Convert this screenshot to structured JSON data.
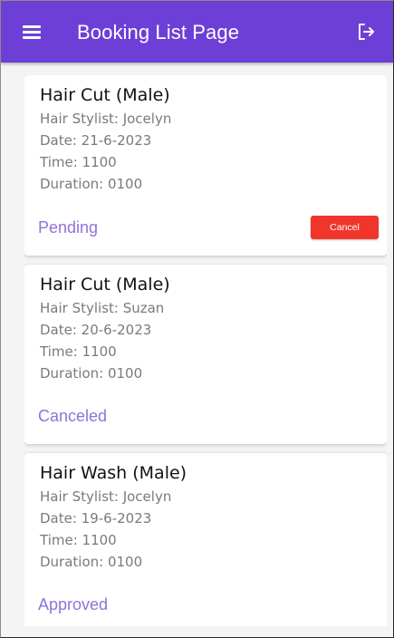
{
  "appbar": {
    "title": "Booking List Page",
    "menu_icon": "menu-icon",
    "logout_icon": "logout-icon",
    "color": "#6e3fd6"
  },
  "bookings": [
    {
      "service": "Hair Cut (Male)",
      "stylist": "Hair Stylist: Jocelyn",
      "date": "Date: 21-6-2023",
      "time": "Time: 1100",
      "duration": "Duration: 0100",
      "status": "Pending",
      "action_label": "Cancel"
    },
    {
      "service": "Hair Cut (Male)",
      "stylist": "Hair Stylist: Suzan",
      "date": "Date: 20-6-2023",
      "time": "Time: 1100",
      "duration": "Duration: 0100",
      "status": "Canceled"
    },
    {
      "service": "Hair Wash (Male)",
      "stylist": "Hair Stylist: Jocelyn",
      "date": "Date: 19-6-2023",
      "time": "Time: 1100",
      "duration": "Duration: 0100",
      "status": "Approved"
    }
  ],
  "colors": {
    "status_text": "#8f73d8",
    "cancel_button": "#f0352b"
  }
}
